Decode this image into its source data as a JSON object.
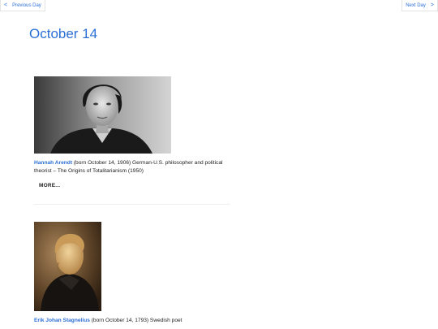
{
  "nav": {
    "prev_arrow": "<",
    "prev_label": "Previous Day",
    "next_label": "Next Day",
    "next_arrow": ">"
  },
  "page": {
    "title": "October 14"
  },
  "entries": [
    {
      "name": "Hannah Arendt",
      "description": " (born October 14, 1906) German-U.S. philosopher and political theorist – The Origins of Totalitarianism (1950)",
      "more_label": "MORE..."
    },
    {
      "name": "Erik Johan Stagnelius",
      "description": " (born October 14, 1793) Swedish poet"
    }
  ]
}
